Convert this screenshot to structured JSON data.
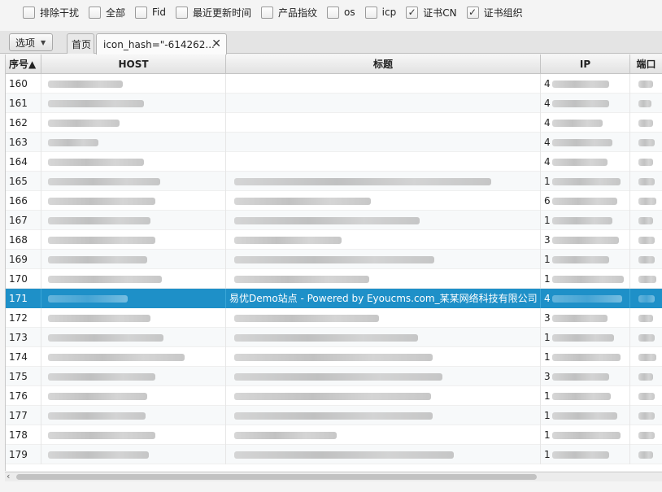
{
  "filters": [
    {
      "label": "排除干扰",
      "checked": false
    },
    {
      "label": "全部",
      "checked": false
    },
    {
      "label": "Fid",
      "checked": false
    },
    {
      "label": "最近更新时间",
      "checked": false
    },
    {
      "label": "产品指纹",
      "checked": false
    },
    {
      "label": "os",
      "checked": false
    },
    {
      "label": "icp",
      "checked": false
    },
    {
      "label": "证书CN",
      "checked": true
    },
    {
      "label": "证书组织",
      "checked": true
    }
  ],
  "toolbar": {
    "options_label": "选项",
    "options_arrow": "▼",
    "home_tab": "首页",
    "active_tab": "icon_hash=\"-614262...",
    "close_glyph": "✕"
  },
  "table": {
    "headers": {
      "index": "序号▲",
      "host": "HOST",
      "title": "标题",
      "ip": "IP",
      "port": "端口"
    },
    "selected_index": 11,
    "rows": [
      {
        "index": "160",
        "ip_lead": "4",
        "title": ""
      },
      {
        "index": "161",
        "ip_lead": "4",
        "title": ""
      },
      {
        "index": "162",
        "ip_lead": "4",
        "title": ""
      },
      {
        "index": "163",
        "ip_lead": "4",
        "title": ""
      },
      {
        "index": "164",
        "ip_lead": "4",
        "title": ""
      },
      {
        "index": "165",
        "ip_lead": "1",
        "title": ""
      },
      {
        "index": "166",
        "ip_lead": "6",
        "title": ""
      },
      {
        "index": "167",
        "ip_lead": "1",
        "title": ""
      },
      {
        "index": "168",
        "ip_lead": "3",
        "title": ""
      },
      {
        "index": "169",
        "ip_lead": "1",
        "title": ""
      },
      {
        "index": "170",
        "ip_lead": "1",
        "title": ""
      },
      {
        "index": "171",
        "ip_lead": "4",
        "title": "易优Demo站点 -  Powered by Eyoucms.com_某某网络科技有限公司"
      },
      {
        "index": "172",
        "ip_lead": "3",
        "title": ""
      },
      {
        "index": "173",
        "ip_lead": "1",
        "title": ""
      },
      {
        "index": "174",
        "ip_lead": "1",
        "title": ""
      },
      {
        "index": "175",
        "ip_lead": "3",
        "title": ""
      },
      {
        "index": "176",
        "ip_lead": "1",
        "title": ""
      },
      {
        "index": "177",
        "ip_lead": "1",
        "title": ""
      },
      {
        "index": "178",
        "ip_lead": "1",
        "title": ""
      },
      {
        "index": "179",
        "ip_lead": "1",
        "title": ""
      }
    ]
  },
  "scrollbar": {
    "left_arrow": "‹"
  }
}
